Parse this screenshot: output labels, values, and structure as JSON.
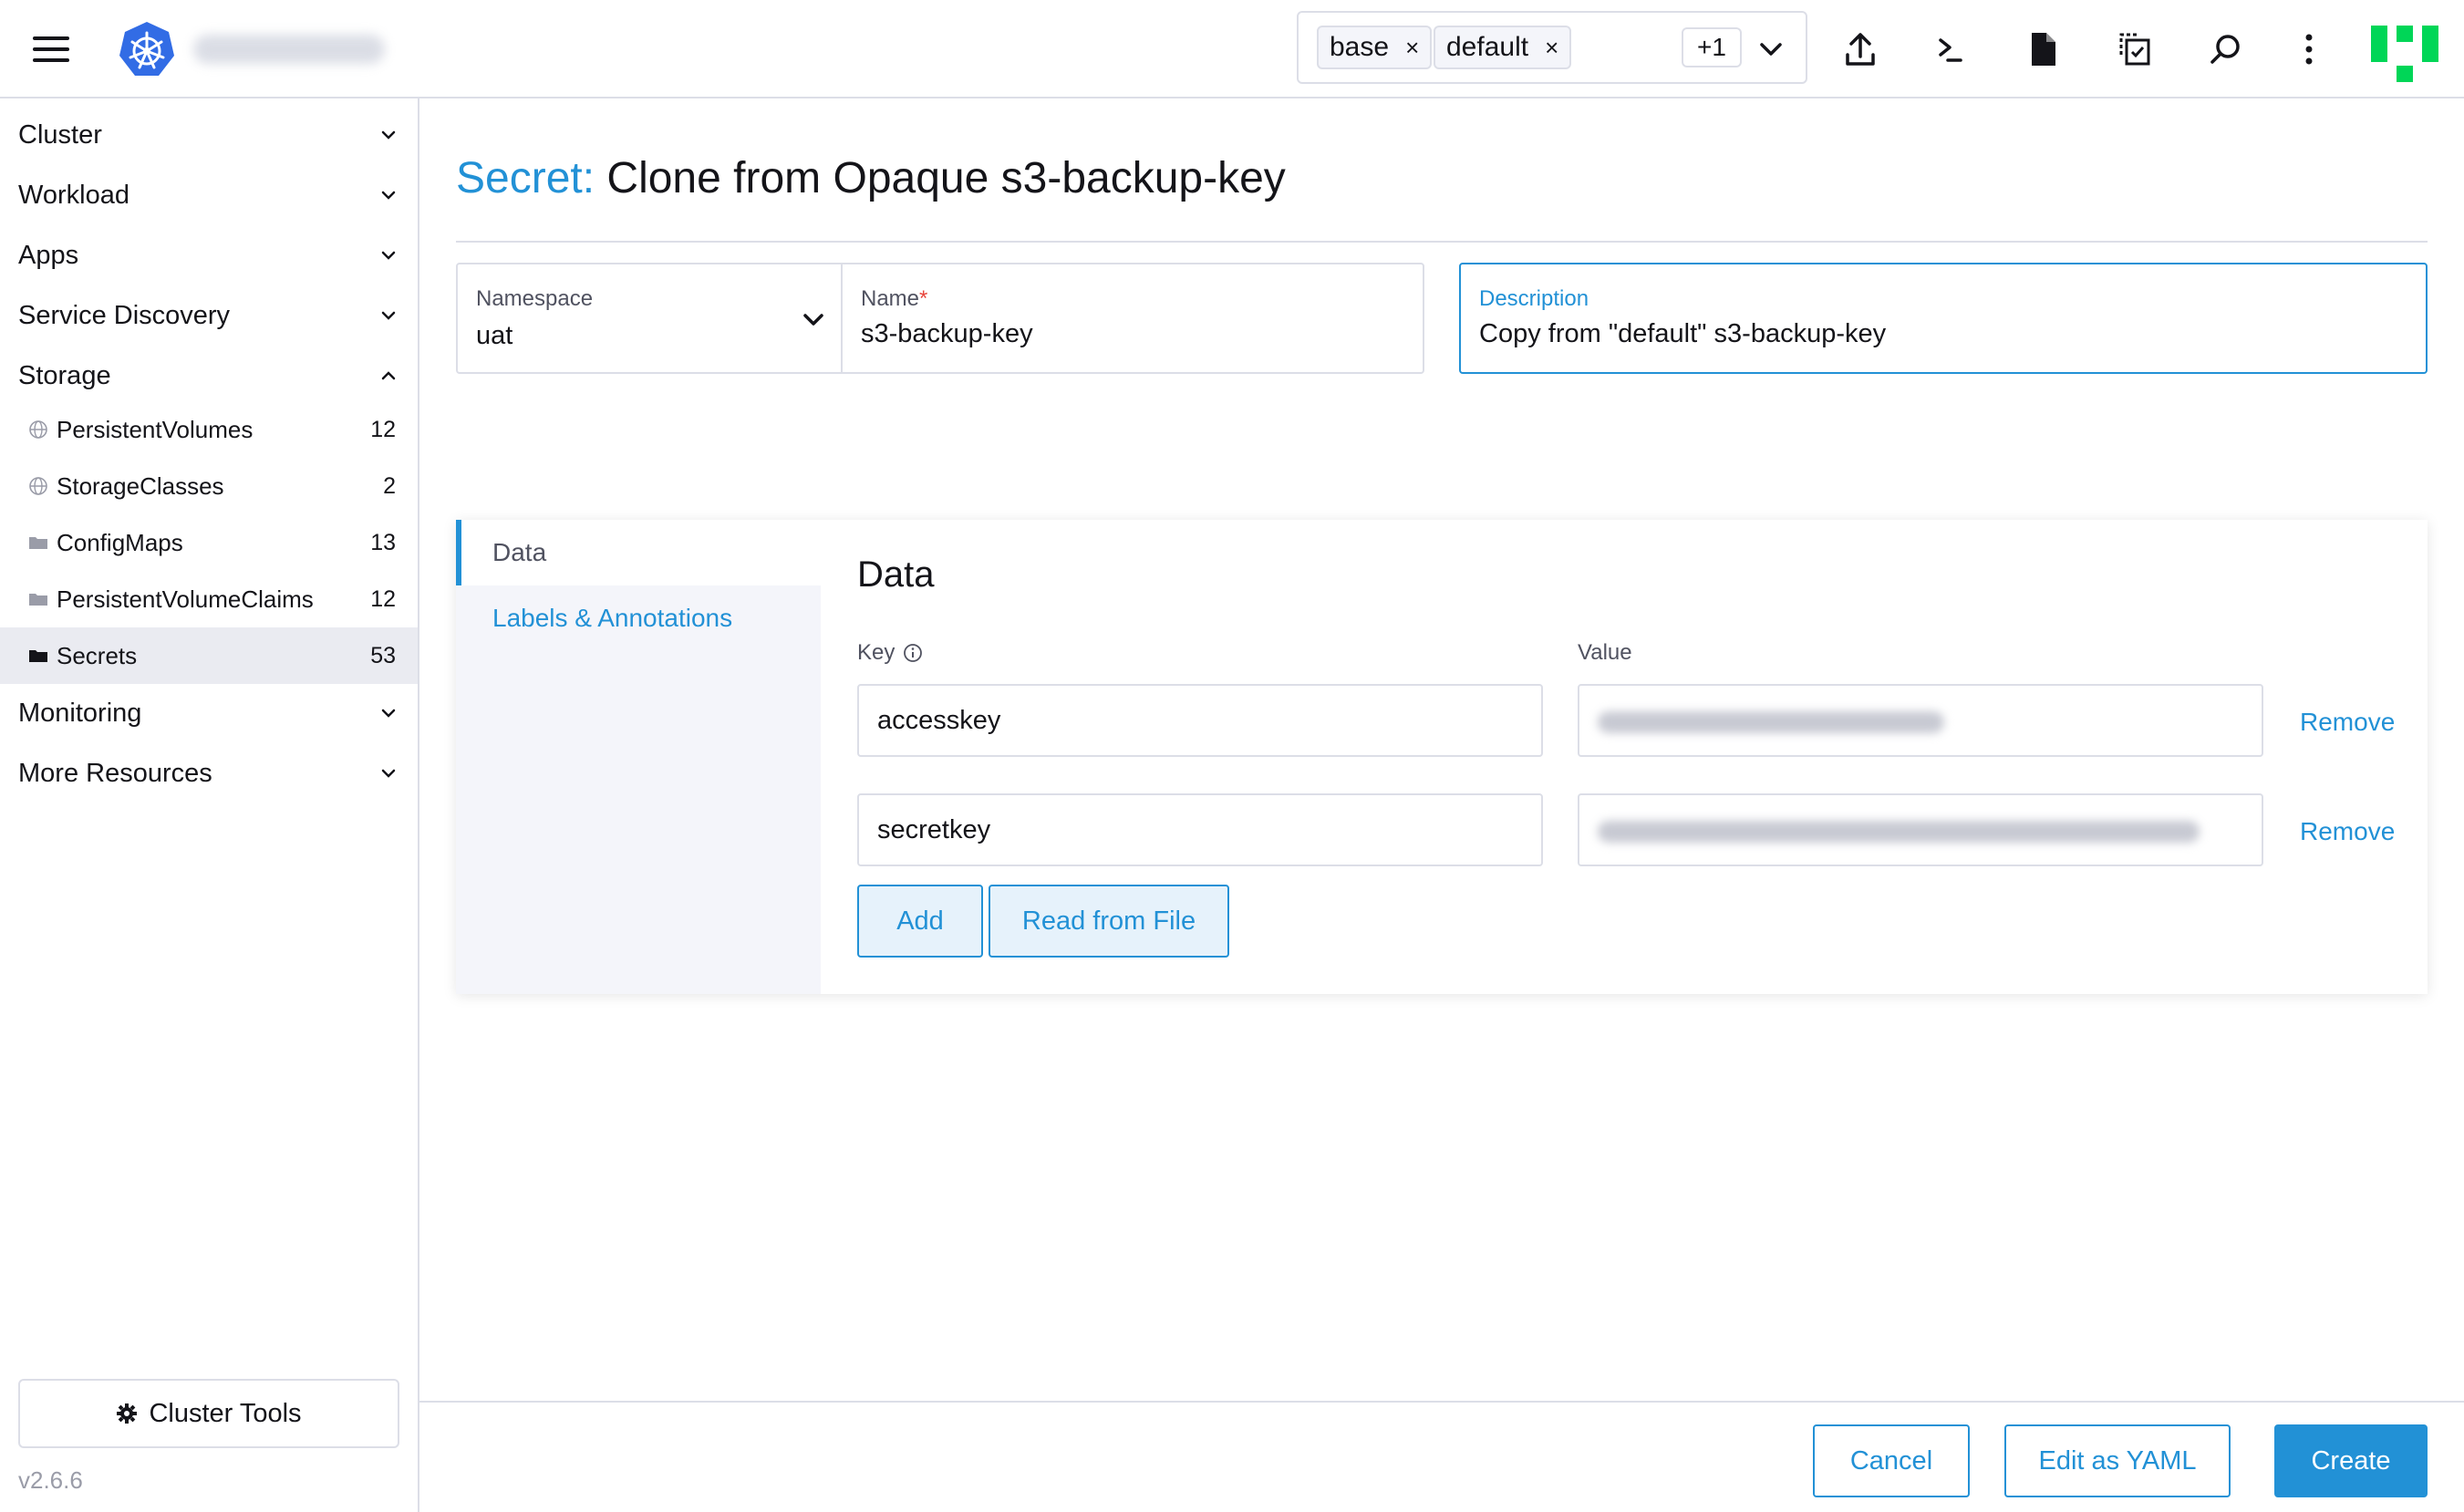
{
  "header": {
    "cluster_name": "",
    "namespace_filter": {
      "chips": [
        {
          "label": "base",
          "remove": "×"
        },
        {
          "label": "default",
          "remove": "×"
        }
      ],
      "more_count": "+1"
    },
    "icons": [
      "upload-icon",
      "terminal-icon",
      "file-icon",
      "copy-config-icon",
      "search-icon",
      "more-vertical-icon"
    ]
  },
  "sidebar": {
    "groups": [
      {
        "label": "Cluster",
        "expanded": false
      },
      {
        "label": "Workload",
        "expanded": false
      },
      {
        "label": "Apps",
        "expanded": false
      },
      {
        "label": "Service Discovery",
        "expanded": false
      },
      {
        "label": "Storage",
        "expanded": true
      },
      {
        "label": "Monitoring",
        "expanded": false
      },
      {
        "label": "More Resources",
        "expanded": false
      }
    ],
    "storage_items": [
      {
        "label": "PersistentVolumes",
        "count": "12",
        "icon": "globe-icon"
      },
      {
        "label": "StorageClasses",
        "count": "2",
        "icon": "globe-icon"
      },
      {
        "label": "ConfigMaps",
        "count": "13",
        "icon": "folder-icon"
      },
      {
        "label": "PersistentVolumeClaims",
        "count": "12",
        "icon": "folder-icon"
      },
      {
        "label": "Secrets",
        "count": "53",
        "icon": "folder-icon",
        "active": true
      }
    ],
    "cluster_tools": "Cluster Tools",
    "version": "v2.6.6"
  },
  "page": {
    "title_type": "Secret:",
    "title_text": "Clone from Opaque s3-backup-key"
  },
  "form": {
    "namespace": {
      "label": "Namespace",
      "value": "uat"
    },
    "name": {
      "label": "Name",
      "required_mark": "*",
      "value": "s3-backup-key"
    },
    "description": {
      "label": "Description",
      "value": "Copy from \"default\" s3-backup-key"
    }
  },
  "tabs": [
    {
      "label": "Data",
      "active": true
    },
    {
      "label": "Labels & Annotations",
      "active": false
    }
  ],
  "data_section": {
    "title": "Data",
    "key_label": "Key",
    "value_label": "Value",
    "rows": [
      {
        "key": "accesskey",
        "remove": "Remove"
      },
      {
        "key": "secretkey",
        "remove": "Remove"
      }
    ],
    "add_label": "Add",
    "read_file_label": "Read from File"
  },
  "footer": {
    "cancel": "Cancel",
    "edit_yaml": "Edit as YAML",
    "create": "Create"
  },
  "colors": {
    "accent": "#2291d6",
    "border": "#dcdee7",
    "sidebar_active": "#eaebf1",
    "brand_green": "#00d657"
  }
}
